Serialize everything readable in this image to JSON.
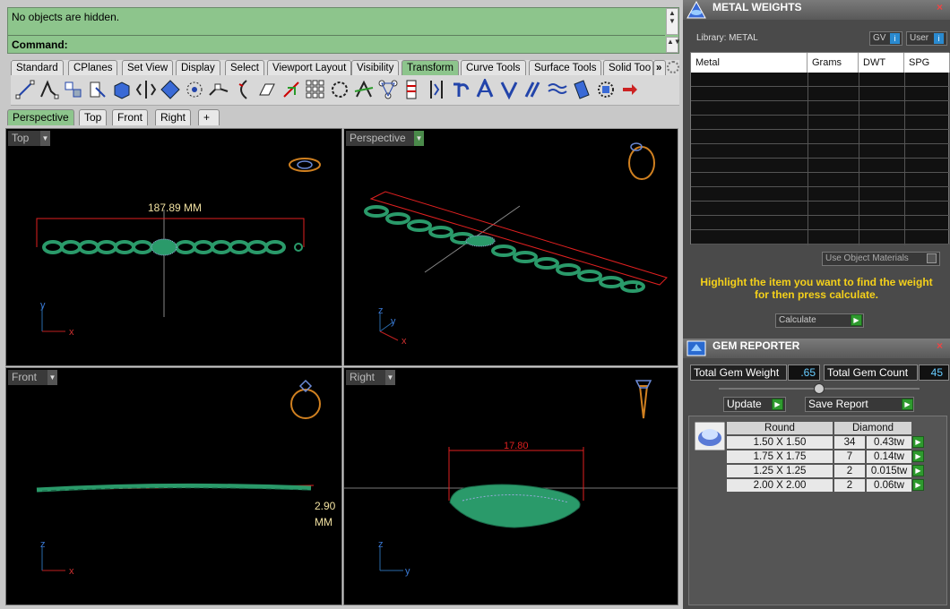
{
  "command": {
    "history_text": "No objects are hidden.",
    "prompt_label": "Command:"
  },
  "toolbar_tabs": [
    "Standard",
    "CPlanes",
    "Set View",
    "Display",
    "Select",
    "Viewport Layout",
    "Visibility",
    "Transform",
    "Curve Tools",
    "Surface Tools",
    "Solid Too"
  ],
  "toolbar_tabs_active": "Transform",
  "toolbar_more": "»",
  "viewport_tabs": [
    "Perspective",
    "Top",
    "Front",
    "Right",
    "+"
  ],
  "viewports": {
    "top": {
      "label": "Top",
      "dimension": "187.89 MM"
    },
    "perspective": {
      "label": "Perspective"
    },
    "front": {
      "label": "Front",
      "dimension_line1": "2.90",
      "dimension_line2": "MM"
    },
    "right": {
      "label": "Right",
      "dimension": "17.80"
    }
  },
  "axis_labels": {
    "x": "x",
    "y": "y",
    "z": "z"
  },
  "metal_weights": {
    "title": "METAL WEIGHTS",
    "library_label": "Library: METAL",
    "gv_label": "GV",
    "user_label": "User",
    "columns": [
      "Metal",
      "Grams",
      "DWT",
      "SPG"
    ],
    "use_object_materials": "Use Object Materials",
    "instruction_line1": "Highlight the item you want to find the weight",
    "instruction_line2": "for then press calculate.",
    "calculate_label": "Calculate"
  },
  "gem_reporter": {
    "title": "GEM REPORTER",
    "total_weight_label": "Total Gem Weight",
    "total_weight_value": ".65",
    "total_count_label": "Total Gem Count",
    "total_count_value": "45",
    "update_label": "Update",
    "save_report_label": "Save Report",
    "header_shape": "Round",
    "header_type": "Diamond",
    "rows": [
      {
        "size": "1.50 X 1.50",
        "count": "34",
        "weight": "0.43tw"
      },
      {
        "size": "1.75 X 1.75",
        "count": "7",
        "weight": "0.14tw"
      },
      {
        "size": "1.25 X 1.25",
        "count": "2",
        "weight": "0.015tw"
      },
      {
        "size": "2.00 X 2.00",
        "count": "2",
        "weight": "0.06tw"
      }
    ]
  },
  "colors": {
    "command_bg": "#8dc58c",
    "model_green": "#2a9a6a",
    "dim_red": "#e02020",
    "dim_text": "#f0e0a0",
    "panel_bg": "#4a4a4a",
    "instruction_text": "#f5d11a"
  }
}
